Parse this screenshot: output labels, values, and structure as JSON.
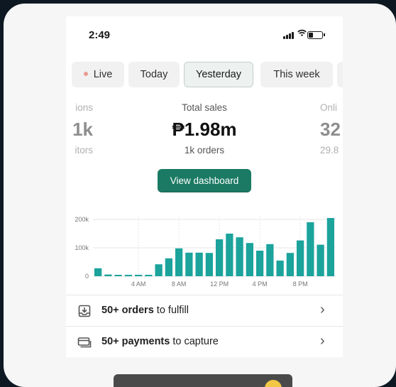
{
  "status_bar": {
    "time": "2:49"
  },
  "tabs": [
    {
      "label": "Live"
    },
    {
      "label": "Today"
    },
    {
      "label": "Yesterday",
      "active": true
    },
    {
      "label": "This week"
    }
  ],
  "metrics": {
    "left": {
      "label": "ions",
      "value": "1k",
      "sub": "itors"
    },
    "center": {
      "label": "Total sales",
      "value": "₱1.98m",
      "sub": "1k orders"
    },
    "right": {
      "label": "Onli",
      "value": "32",
      "sub": "29.8"
    }
  },
  "view_dashboard_label": "View dashboard",
  "chart_data": {
    "type": "bar",
    "y_ticks": [
      "200k",
      "100k",
      "0"
    ],
    "x_ticks": [
      "4 AM",
      "8 AM",
      "12 PM",
      "4 PM",
      "8 PM"
    ],
    "ylim": [
      0,
      200000
    ],
    "values": [
      28000,
      6000,
      5000,
      5000,
      5000,
      5000,
      42000,
      63000,
      98000,
      83000,
      83000,
      82000,
      130000,
      150000,
      137000,
      117000,
      90000,
      113000,
      55000,
      82000,
      126000,
      190000,
      111000,
      205000
    ],
    "color": "#1ba39c"
  },
  "list": [
    {
      "bold": "50+ orders",
      "rest": " to fulfill",
      "icon": "fulfill-icon"
    },
    {
      "bold": "50+ payments",
      "rest": " to capture",
      "icon": "payment-card-icon"
    }
  ],
  "colors": {
    "background": "#0d1822",
    "accent": "#1b7a63",
    "bar": "#1ba39c",
    "live_dot": "#e99b91"
  }
}
